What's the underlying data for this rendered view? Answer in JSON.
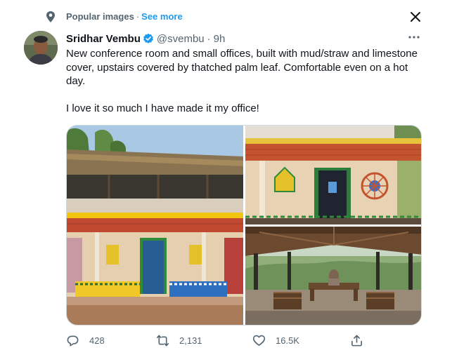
{
  "context": {
    "label": "Popular images",
    "separator": "·",
    "see_more": "See more"
  },
  "tweet": {
    "author_name": "Sridhar Vembu",
    "handle": "@svembu",
    "separator": "·",
    "time": "9h",
    "paragraphs": [
      "New conference room and small offices, built with mud/straw and limestone cover, upstairs covered by thatched palm leaf. Comfortable even on a hot day.",
      "I love it so much I have made it my office!"
    ],
    "images": [
      {
        "icon": "photo-two-storey-mud-building"
      },
      {
        "icon": "photo-building-facade-with-art"
      },
      {
        "icon": "photo-thatched-conference-room"
      }
    ]
  },
  "actions": {
    "replies": "428",
    "retweets": "2,131",
    "likes": "16.5K"
  },
  "colors": {
    "accent": "#1d9bf0",
    "secondary_text": "#536471",
    "primary_text": "#0f1419"
  }
}
